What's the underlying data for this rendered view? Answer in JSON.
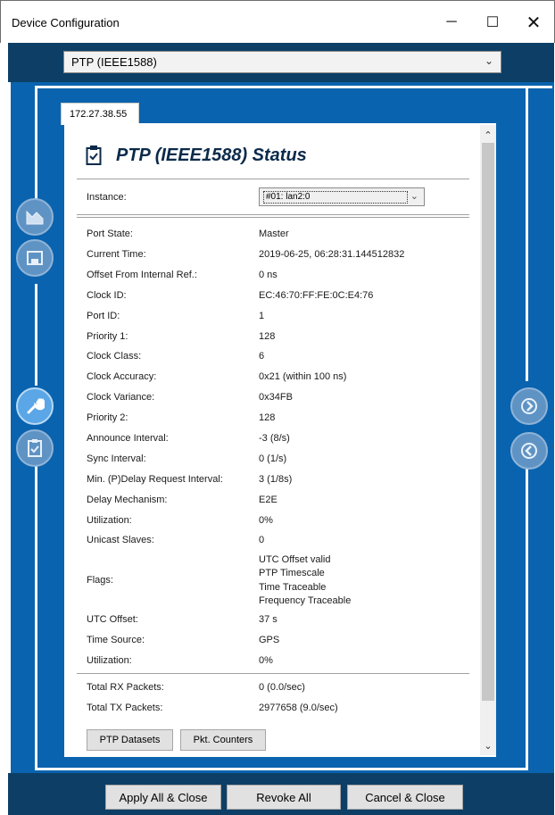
{
  "window": {
    "title": "Device Configuration",
    "min_glyph": "─",
    "max_glyph": "☐",
    "close_glyph": "✕"
  },
  "protocol_select": {
    "value": "PTP (IEEE1588)",
    "chevron": "⌄"
  },
  "tab": {
    "label": "172.27.38.55"
  },
  "panel": {
    "title": "PTP (IEEE1588) Status",
    "instance_label": "Instance:",
    "instance_value": "#01: lan2:0",
    "rows": [
      {
        "label": "Port State:",
        "value": "Master"
      },
      {
        "label": "Current Time:",
        "value": "2019-06-25, 06:28:31.144512832"
      },
      {
        "label": "Offset From Internal Ref.:",
        "value": "0 ns"
      },
      {
        "label": "Clock ID:",
        "value": "EC:46:70:FF:FE:0C:E4:76"
      },
      {
        "label": "Port ID:",
        "value": "1"
      },
      {
        "label": "Priority 1:",
        "value": "128"
      },
      {
        "label": "Clock Class:",
        "value": "6"
      },
      {
        "label": "Clock Accuracy:",
        "value": "0x21 (within 100 ns)"
      },
      {
        "label": "Clock Variance:",
        "value": "0x34FB"
      },
      {
        "label": "Priority 2:",
        "value": "128"
      },
      {
        "label": "Announce Interval:",
        "value": "-3 (8/s)"
      },
      {
        "label": "Sync Interval:",
        "value": "0 (1/s)"
      },
      {
        "label": "Min. (P)Delay Request Interval:",
        "value": "3 (1/8s)"
      },
      {
        "label": "Delay Mechanism:",
        "value": "E2E"
      },
      {
        "label": "Utilization:",
        "value": "0%"
      },
      {
        "label": "Unicast Slaves:",
        "value": "0"
      }
    ],
    "flags_label": "Flags:",
    "flags": [
      "UTC Offset valid",
      "PTP Timescale",
      "Time Traceable",
      "Frequency Traceable"
    ],
    "rows2": [
      {
        "label": "UTC Offset:",
        "value": "37 s"
      },
      {
        "label": "Time Source:",
        "value": "GPS"
      },
      {
        "label": "Utilization:",
        "value": "0%"
      }
    ],
    "packets": [
      {
        "label": "Total RX Packets:",
        "value": "0 (0.0/sec)"
      },
      {
        "label": "Total TX Packets:",
        "value": "2977658 (9.0/sec)"
      }
    ],
    "buttons": {
      "datasets": "PTP Datasets",
      "counters": "Pkt. Counters"
    }
  },
  "scrollbar": {
    "up": "⌃",
    "down": "⌄"
  },
  "footer": {
    "apply": "Apply All & Close",
    "revoke": "Revoke All",
    "cancel": "Cancel & Close"
  },
  "colors": {
    "main_blue": "#0a63ae",
    "dark_bar": "#0d3f66",
    "title_text": "#0b2a4a"
  },
  "icons": [
    "chart-icon",
    "save-icon",
    "wrench-icon",
    "clipboard-icon",
    "forward-icon",
    "back-icon",
    "status-clipboard-icon"
  ]
}
